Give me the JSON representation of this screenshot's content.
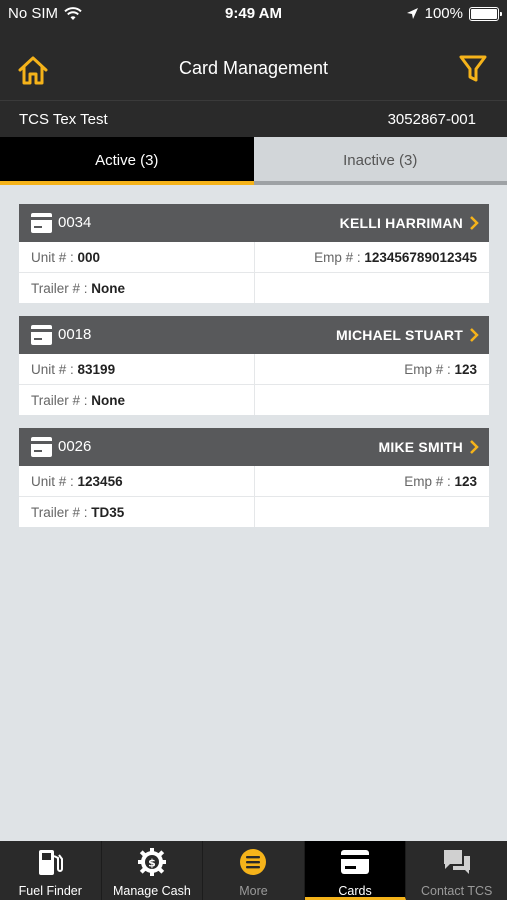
{
  "status_bar": {
    "carrier": "No SIM",
    "time": "9:49 AM",
    "battery": "100%"
  },
  "header": {
    "title": "Card Management"
  },
  "account": {
    "name": "TCS Tex Test",
    "number": "3052867-001"
  },
  "tabs": {
    "active_label": "Active (3)",
    "inactive_label": "Inactive (3)"
  },
  "cards": [
    {
      "card_number": "0034",
      "holder": "KELLI HARRIMAN",
      "unit_label": "Unit # :",
      "unit": " 000",
      "emp_label": "Emp # :",
      "emp": " 123456789012345",
      "trailer_label": "Trailer # :",
      "trailer": " None"
    },
    {
      "card_number": "0018",
      "holder": "MICHAEL STUART",
      "unit_label": "Unit # :",
      "unit": " 83199",
      "emp_label": "Emp # :",
      "emp": " 123",
      "trailer_label": "Trailer # :",
      "trailer": " None"
    },
    {
      "card_number": "0026",
      "holder": "MIKE SMITH",
      "unit_label": "Unit # :",
      "unit": " 123456",
      "emp_label": "Emp # :",
      "emp": " 123",
      "trailer_label": "Trailer # :",
      "trailer": " TD35"
    }
  ],
  "tabbar": {
    "fuel_finder": "Fuel Finder",
    "manage_cash": "Manage Cash",
    "more": "More",
    "cards": "Cards",
    "contact": "Contact TCS"
  },
  "colors": {
    "accent": "#f5b31a",
    "header_bg": "#2a2a2a",
    "card_head": "#58595b",
    "background": "#dfe3e6"
  },
  "icons": {
    "home": "home-icon",
    "filter": "filter-icon",
    "card": "credit-card-icon",
    "chevron": "chevron-right-icon",
    "fuel": "fuel-pump-icon",
    "cash": "dollar-gear-icon",
    "more": "menu-circle-icon",
    "cards": "card-icon",
    "contact": "chat-bubbles-icon"
  }
}
